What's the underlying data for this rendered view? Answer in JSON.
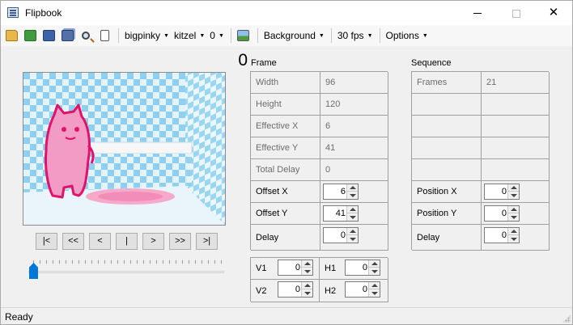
{
  "window": {
    "title": "Flipbook"
  },
  "toolbar": {
    "icons": [
      "open-folder-icon",
      "refresh-icon",
      "save-icon",
      "save-all-icon",
      "search-icon",
      "page-icon"
    ],
    "dropdowns": [
      "bigpinky",
      "kitzel",
      "0"
    ],
    "image_icon": "image-icon",
    "background": "Background",
    "fps": "30 fps",
    "options": "Options"
  },
  "preview": {
    "frame_number": "0"
  },
  "nav": {
    "first": "|<",
    "prev_fast": "<<",
    "prev": "<",
    "stop": "|",
    "next": ">",
    "next_fast": ">>",
    "last": ">|"
  },
  "slider": {
    "value": 0
  },
  "frame": {
    "label": "Frame",
    "rows": [
      {
        "label": "Width",
        "value": "96"
      },
      {
        "label": "Height",
        "value": "120"
      },
      {
        "label": "Effective X",
        "value": "6"
      },
      {
        "label": "Effective Y",
        "value": "41"
      },
      {
        "label": "Total Delay",
        "value": "0"
      }
    ],
    "offset_x": {
      "label": "Offset X",
      "value": "6"
    },
    "offset_y": {
      "label": "Offset Y",
      "value": "41"
    },
    "delay": {
      "label": "Delay",
      "value": "0"
    }
  },
  "sequence": {
    "label": "Sequence",
    "frames": {
      "label": "Frames",
      "value": "21"
    },
    "position_x": {
      "label": "Position X",
      "value": "0"
    },
    "position_y": {
      "label": "Position Y",
      "value": "0"
    },
    "delay": {
      "label": "Delay",
      "value": "0"
    }
  },
  "vh": {
    "v1": {
      "label": "V1",
      "value": "0"
    },
    "h1": {
      "label": "H1",
      "value": "0"
    },
    "v2": {
      "label": "V2",
      "value": "0"
    },
    "h2": {
      "label": "H2",
      "value": "0"
    }
  },
  "status": {
    "text": "Ready"
  },
  "colors": {
    "accent": "#0078d7",
    "character": "#f29bc4",
    "outline": "#e0126a"
  }
}
